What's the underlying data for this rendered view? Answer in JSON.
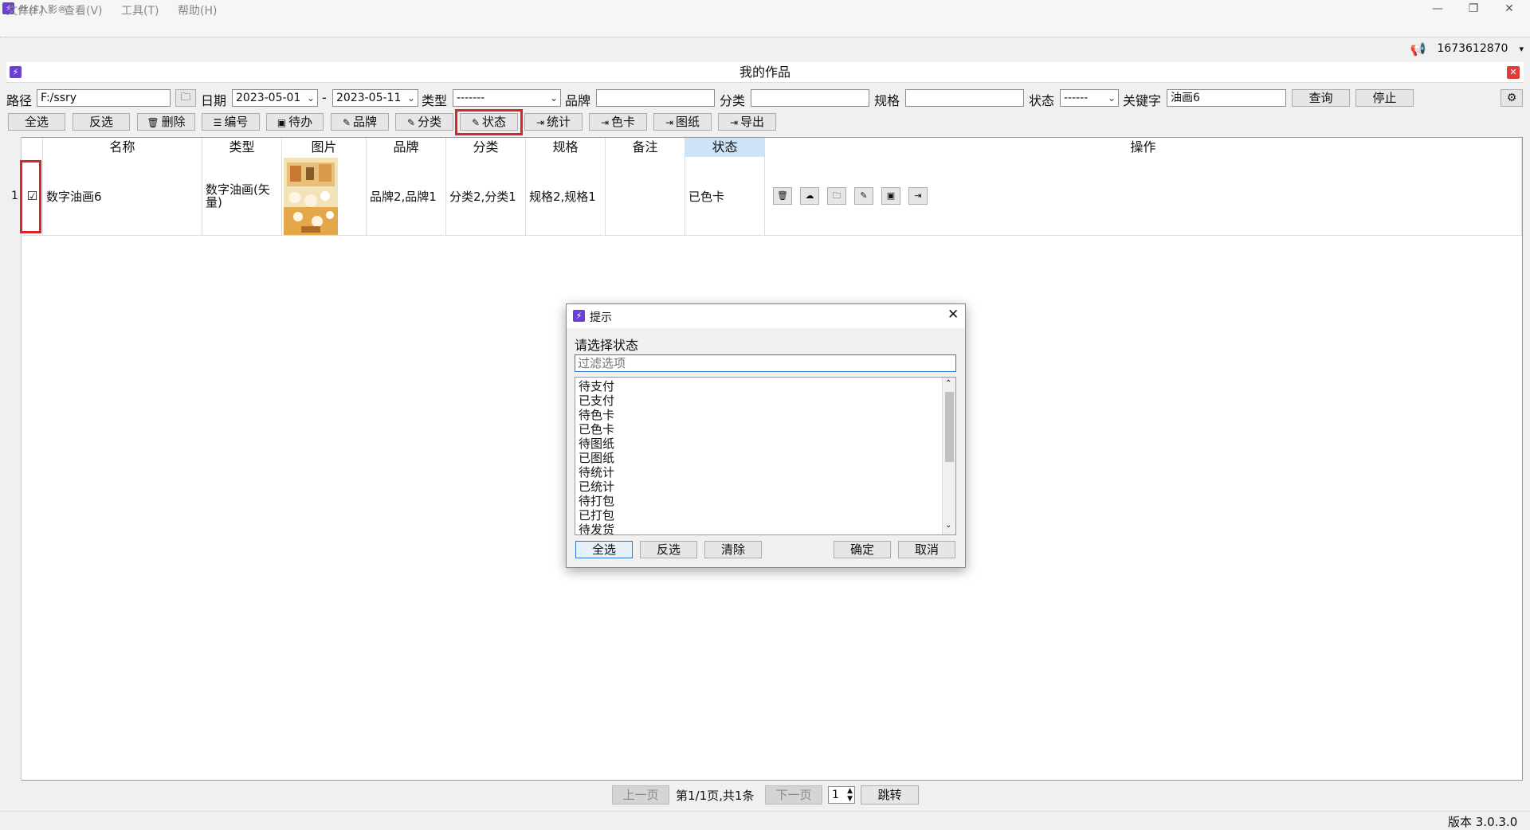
{
  "window": {
    "title": "丝丝入影®",
    "minimize": "—",
    "restore": "❐",
    "close": "✕"
  },
  "menu": [
    "文件(F)",
    "查看(V)",
    "工具(T)",
    "帮助(H)"
  ],
  "user": {
    "id": "1673612870",
    "caret": "▾"
  },
  "panel": {
    "title": "我的作品",
    "close": "✕"
  },
  "filters": {
    "path_label": "路径",
    "path_value": "F:/ssry",
    "date_label": "日期",
    "date_from": "2023-05-01",
    "date_sep": "-",
    "date_to": "2023-05-11",
    "type_label": "类型",
    "type_value": "-------",
    "brand_label": "品牌",
    "brand_value": "",
    "category_label": "分类",
    "category_value": "",
    "spec_label": "规格",
    "spec_value": "",
    "status_label": "状态",
    "status_value": "------",
    "keyword_label": "关键字",
    "keyword_value": "油画6",
    "query_btn": "查询",
    "stop_btn": "停止"
  },
  "toolbar": {
    "select_all": "全选",
    "invert": "反选",
    "delete": "删除",
    "number": "编号",
    "todo": "待办",
    "brand": "品牌",
    "category": "分类",
    "status": "状态",
    "stats": "统计",
    "color_card": "色卡",
    "drawing": "图纸",
    "export": "导出"
  },
  "table": {
    "columns": [
      "名称",
      "类型",
      "图片",
      "品牌",
      "分类",
      "规格",
      "备注",
      "状态",
      "操作"
    ],
    "rows": [
      {
        "index": "1",
        "checked": "☑",
        "name": "数字油画6",
        "type": "数字油画(矢量)",
        "brand": "品牌2,品牌1",
        "category": "分类2,分类1",
        "spec": "规格2,规格1",
        "note": "",
        "status": "已色卡"
      }
    ]
  },
  "pager": {
    "prev": "上一页",
    "info": "第1/1页,共1条",
    "next": "下一页",
    "page": "1",
    "jump": "跳转"
  },
  "version": "版本 3.0.3.0",
  "dialog": {
    "title": "提示",
    "prompt": "请选择状态",
    "filter_placeholder": "过滤选项",
    "options": [
      "待支付",
      "已支付",
      "待色卡",
      "已色卡",
      "待图纸",
      "已图纸",
      "待统计",
      "已统计",
      "待打包",
      "已打包",
      "待发货"
    ],
    "select_all": "全选",
    "invert": "反选",
    "clear": "清除",
    "ok": "确定",
    "cancel": "取消"
  }
}
